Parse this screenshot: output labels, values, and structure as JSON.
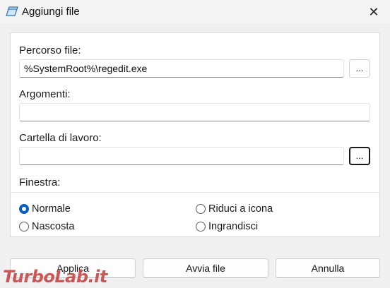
{
  "window": {
    "title": "Aggiungi file",
    "close_glyph": "✕"
  },
  "file_path": {
    "label": "Percorso file:",
    "value": "%SystemRoot%\\regedit.exe",
    "browse_label": "..."
  },
  "arguments": {
    "label": "Argomenti:",
    "value": ""
  },
  "working_dir": {
    "label": "Cartella di lavoro:",
    "value": "",
    "browse_label": "..."
  },
  "window_mode": {
    "label": "Finestra:",
    "options": [
      {
        "label": "Normale",
        "selected": true
      },
      {
        "label": "Riduci a icona",
        "selected": false
      },
      {
        "label": "Nascosta",
        "selected": false
      },
      {
        "label": "Ingrandisci",
        "selected": false
      }
    ]
  },
  "buttons": {
    "apply": "Applica",
    "launch": "Avvia file",
    "cancel": "Annulla"
  },
  "watermark": {
    "text": "TurboLab.it"
  },
  "colors": {
    "accent": "#0a5fc7",
    "watermark": "#be1e1e"
  },
  "icons": {
    "app": "window-icon",
    "close": "close-icon",
    "radio": "radio-icon"
  }
}
